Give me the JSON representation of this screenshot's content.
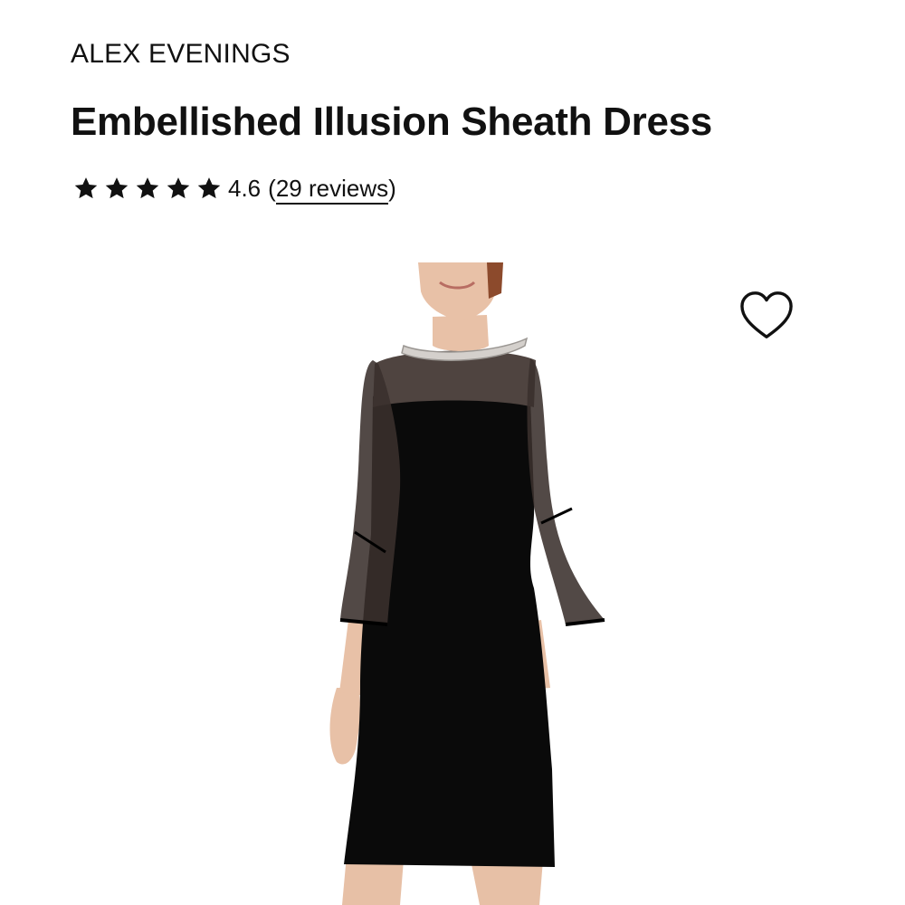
{
  "product": {
    "brand": "ALEX EVENINGS",
    "title": "Embellished Illusion Sheath Dress",
    "rating": {
      "stars": 5,
      "value": "4.6",
      "open_paren": "(",
      "reviews_text": "29 reviews",
      "close_paren": ")"
    },
    "image": {
      "alt": "Embellished Illusion Sheath Dress",
      "dress_color": "#0a0a0a",
      "skin_color": "#e8c0a6",
      "hair_color": "#8c4a2c"
    },
    "wishlist_icon": "heart-outline-icon"
  }
}
